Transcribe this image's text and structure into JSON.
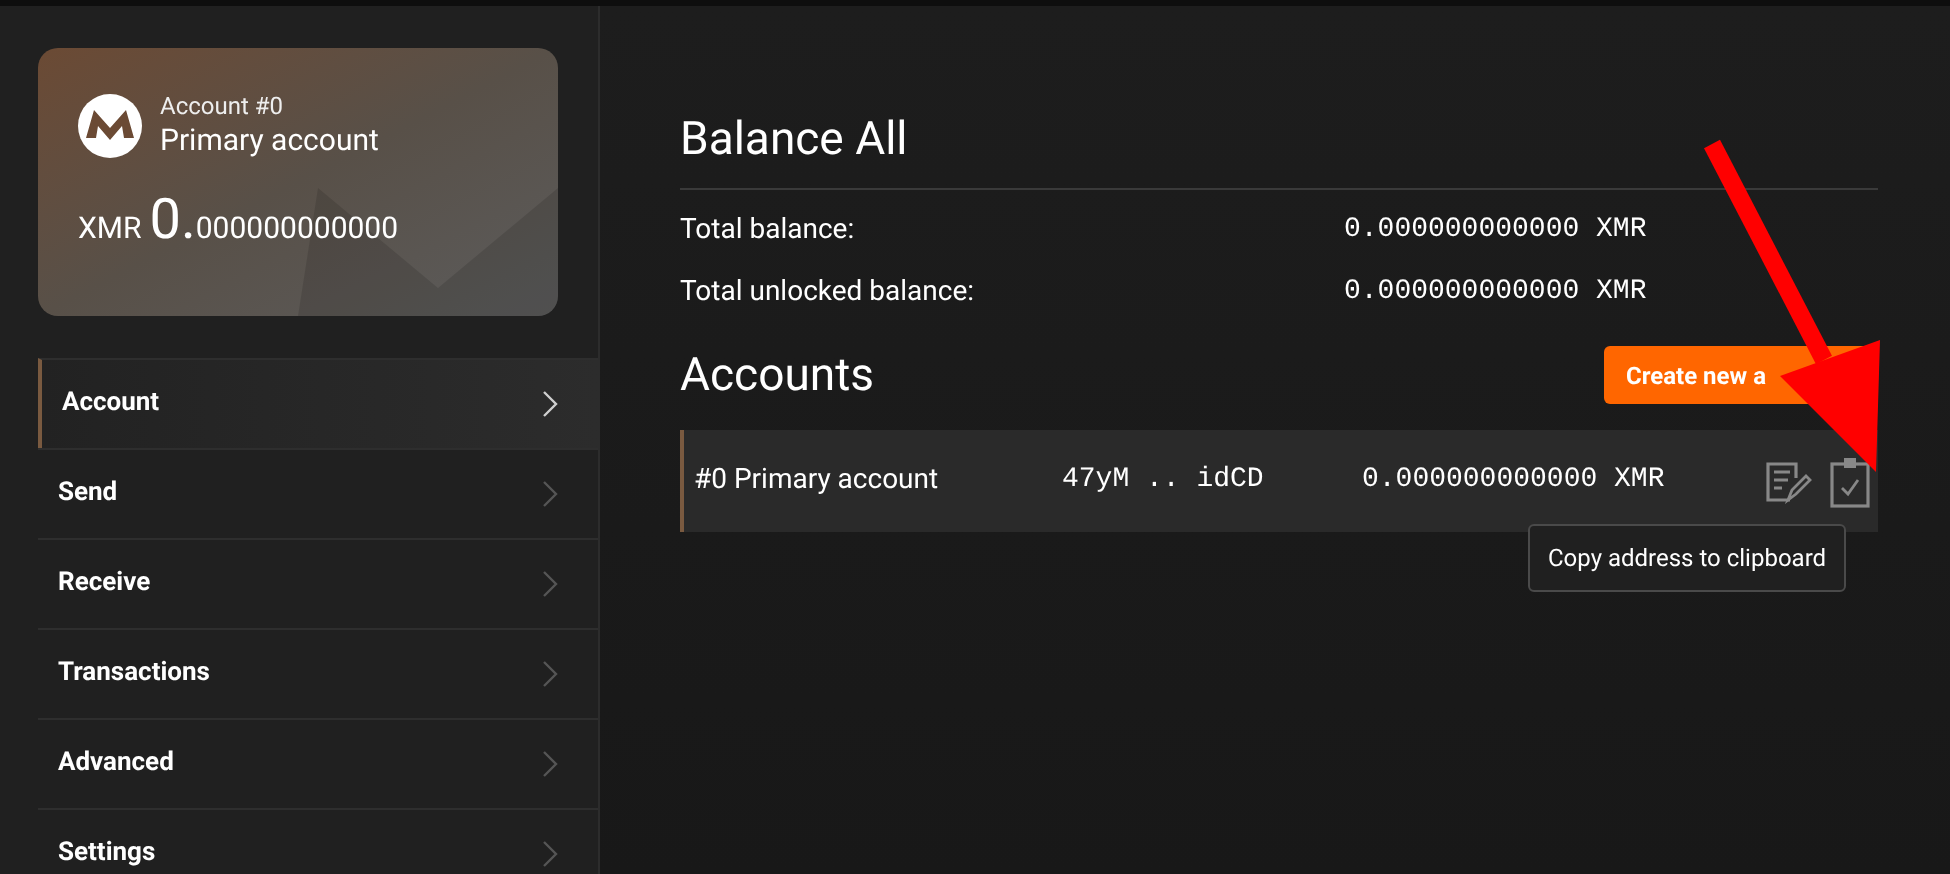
{
  "account_card": {
    "label": "Account #0",
    "name": "Primary account",
    "currency": "XMR",
    "balance_whole": "0.",
    "balance_fraction": "000000000000"
  },
  "menu": [
    {
      "label": "Account",
      "selected": true
    },
    {
      "label": "Send",
      "selected": false
    },
    {
      "label": "Receive",
      "selected": false
    },
    {
      "label": "Transactions",
      "selected": false
    },
    {
      "label": "Advanced",
      "selected": false
    },
    {
      "label": "Settings",
      "selected": false
    }
  ],
  "balance": {
    "title": "Balance All",
    "rows": [
      {
        "label": "Total balance:",
        "value": "0.000000000000 XMR"
      },
      {
        "label": "Total unlocked balance:",
        "value": "0.000000000000 XMR"
      }
    ]
  },
  "accounts": {
    "title": "Accounts",
    "create_button": "Create new a",
    "rows": [
      {
        "name": "#0 Primary account",
        "address": "47yM .. idCD",
        "balance": "0.000000000000 XMR",
        "selected": true
      }
    ]
  },
  "tooltip": "Copy address to clipboard"
}
